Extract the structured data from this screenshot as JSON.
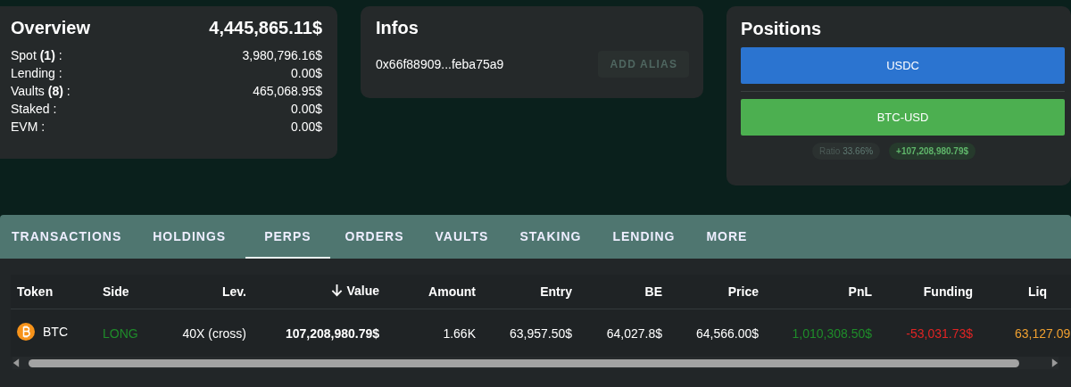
{
  "overview": {
    "title": "Overview",
    "total": "4,445,865.11$",
    "rows": [
      {
        "label": "Spot **(1)** :",
        "value": "3,980,796.16$"
      },
      {
        "label": "Lending :",
        "value": "0.00$"
      },
      {
        "label": "Vaults **(8)** :",
        "value": "465,068.95$"
      },
      {
        "label": "Staked :",
        "value": "0.00$"
      },
      {
        "label": "EVM :",
        "value": "0.00$"
      }
    ]
  },
  "infos": {
    "title": "Infos",
    "address": "0x66f88909...feba75a9",
    "button": {
      "label": "ADD ALIAS",
      "disabled": true
    }
  },
  "positions": {
    "title": "Positions",
    "bars": [
      {
        "label": "USDC",
        "color": "#2b74d0"
      },
      {
        "label": "BTC-USD",
        "color": "#4caf50"
      }
    ],
    "ratio_label": "Ratio",
    "ratio_value": "33.66%",
    "pnl": "+107,208,980.79$"
  },
  "tabs": [
    {
      "label": "TRANSACTIONS",
      "selected": false
    },
    {
      "label": "HOLDINGS",
      "selected": false
    },
    {
      "label": "PERPS",
      "selected": true
    },
    {
      "label": "ORDERS",
      "selected": false
    },
    {
      "label": "VAULTS",
      "selected": false
    },
    {
      "label": "STAKING",
      "selected": false
    },
    {
      "label": "LENDING",
      "selected": false
    },
    {
      "label": "MORE",
      "selected": false
    }
  ],
  "table": {
    "columns": [
      {
        "label": "Token",
        "sorted": false
      },
      {
        "label": "Side",
        "sorted": false
      },
      {
        "label": "Lev.",
        "sorted": false
      },
      {
        "label": "Value",
        "sorted": true
      },
      {
        "label": "Amount",
        "sorted": false
      },
      {
        "label": "Entry",
        "sorted": false
      },
      {
        "label": "BE",
        "sorted": false
      },
      {
        "label": "Price",
        "sorted": false
      },
      {
        "label": "PnL",
        "sorted": false
      },
      {
        "label": "Funding",
        "sorted": false
      },
      {
        "label": "Liq",
        "sorted": false
      }
    ],
    "rows": [
      {
        "cells": [
          {
            "text": "BTC",
            "kind": "token"
          },
          {
            "text": "LONG",
            "kind": "positive"
          },
          {
            "text": "40X (cross)",
            "kind": "plain"
          },
          {
            "text": "107,208,980.79$",
            "kind": "bold"
          },
          {
            "text": "1.66K",
            "kind": "plain"
          },
          {
            "text": "63,957.50$",
            "kind": "plain"
          },
          {
            "text": "64,027.8$",
            "kind": "plain"
          },
          {
            "text": "64,566.00$",
            "kind": "plain"
          },
          {
            "text": "1,010,308.50$",
            "kind": "positive"
          },
          {
            "text": "-53,031.73$",
            "kind": "negative"
          },
          {
            "text": "63,127.09",
            "kind": "warning"
          }
        ]
      }
    ]
  }
}
